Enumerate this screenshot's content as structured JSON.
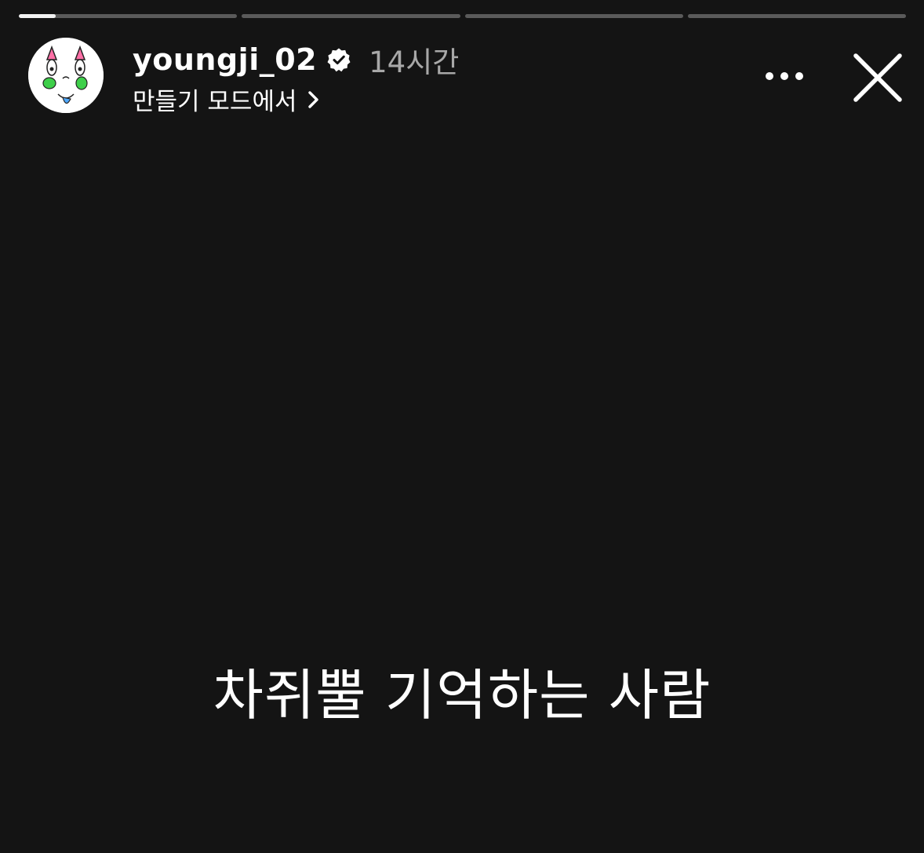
{
  "story": {
    "progress": [
      0.17,
      0,
      0,
      0
    ],
    "username": "youngji_02",
    "verified": true,
    "time_ago": "14시간",
    "create_mode_label": "만들기 모드에서",
    "caption": "차쥐뿔 기억하는 사람"
  },
  "icons": {
    "verified": "verified-badge-icon",
    "chevron": "chevron-right-icon",
    "more": "more-options-icon",
    "close": "close-icon"
  },
  "colors": {
    "background": "#141414",
    "progress_track": "#5a5a5a",
    "progress_fill": "#f2f2f2",
    "time_text": "#a8a8a8"
  }
}
